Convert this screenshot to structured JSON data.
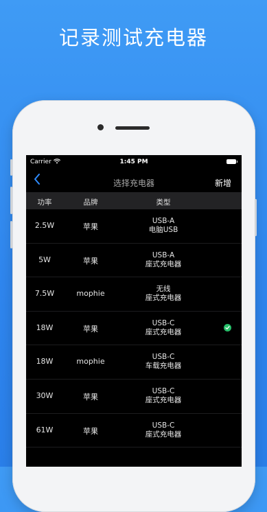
{
  "headline": "记录测试充电器",
  "status_bar": {
    "carrier": "Carrier",
    "time": "1:45 PM"
  },
  "nav": {
    "title": "选择充电器",
    "add_label": "新增"
  },
  "table": {
    "headers": {
      "power": "功率",
      "brand": "品牌",
      "type": "类型"
    },
    "rows": [
      {
        "power": "2.5W",
        "brand": "苹果",
        "type_line1": "USB-A",
        "type_line2": "电脑USB",
        "selected": false
      },
      {
        "power": "5W",
        "brand": "苹果",
        "type_line1": "USB-A",
        "type_line2": "座式充电器",
        "selected": false
      },
      {
        "power": "7.5W",
        "brand": "mophie",
        "type_line1": "无线",
        "type_line2": "座式充电器",
        "selected": false
      },
      {
        "power": "18W",
        "brand": "苹果",
        "type_line1": "USB-C",
        "type_line2": "座式充电器",
        "selected": true
      },
      {
        "power": "18W",
        "brand": "mophie",
        "type_line1": "USB-C",
        "type_line2": "车载充电器",
        "selected": false
      },
      {
        "power": "30W",
        "brand": "苹果",
        "type_line1": "USB-C",
        "type_line2": "座式充电器",
        "selected": false
      },
      {
        "power": "61W",
        "brand": "苹果",
        "type_line1": "USB-C",
        "type_line2": "座式充电器",
        "selected": false
      }
    ]
  },
  "colors": {
    "background": "#3a93f3",
    "accent": "#2f8cff",
    "check": "#27c06a"
  },
  "icons": {
    "back": "chevron-left-icon",
    "wifi": "wifi-icon",
    "battery": "battery-icon",
    "selected": "checkmark-circle-icon"
  }
}
